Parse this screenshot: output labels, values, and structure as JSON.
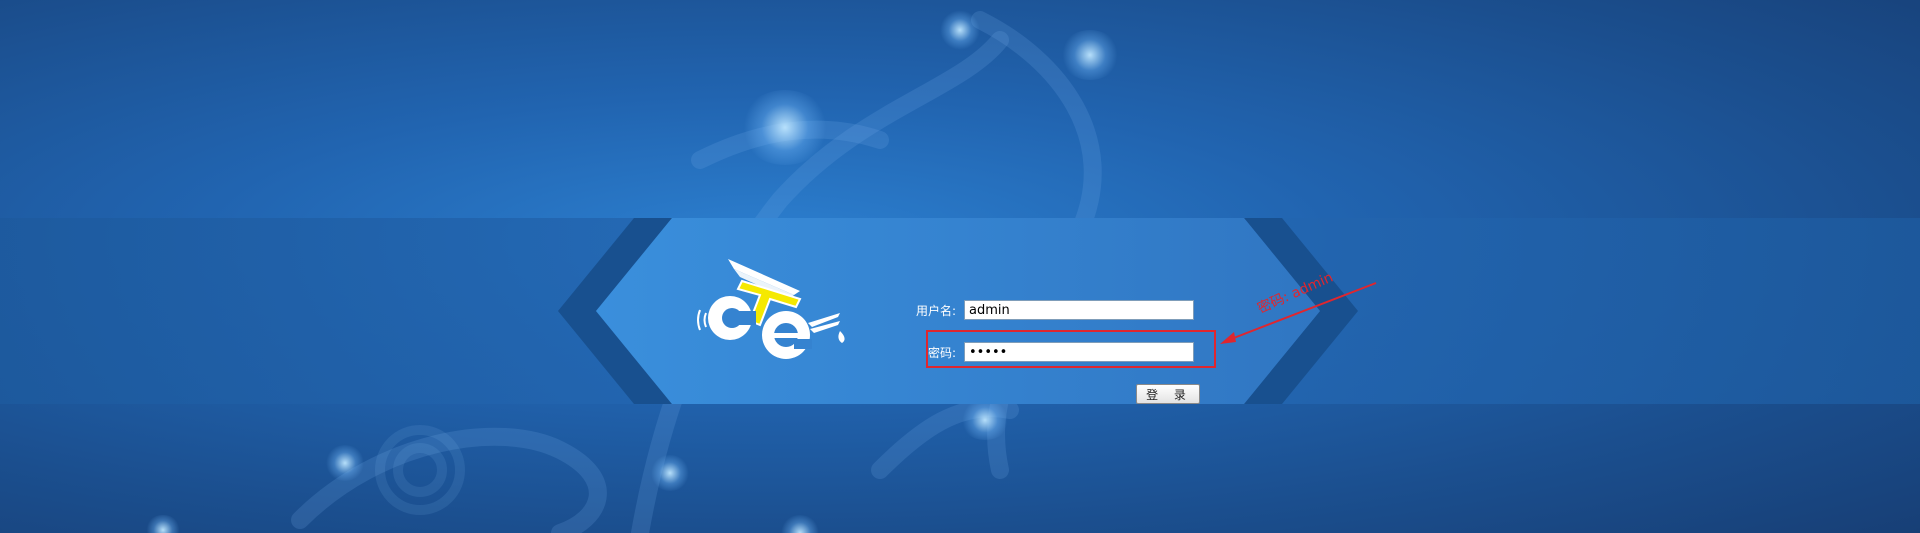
{
  "login_form": {
    "username_label": "用户名:",
    "username_value": "admin",
    "password_label": "密码:",
    "password_value": "admin",
    "login_button_label": "登 录"
  },
  "annotation": {
    "text": "密码: admin",
    "color": "#e0262e"
  },
  "logo": {
    "name": "cte-logo"
  },
  "colors": {
    "background": "#2164b0",
    "highlight": "#e0262e",
    "logo_yellow": "#f5e900"
  }
}
